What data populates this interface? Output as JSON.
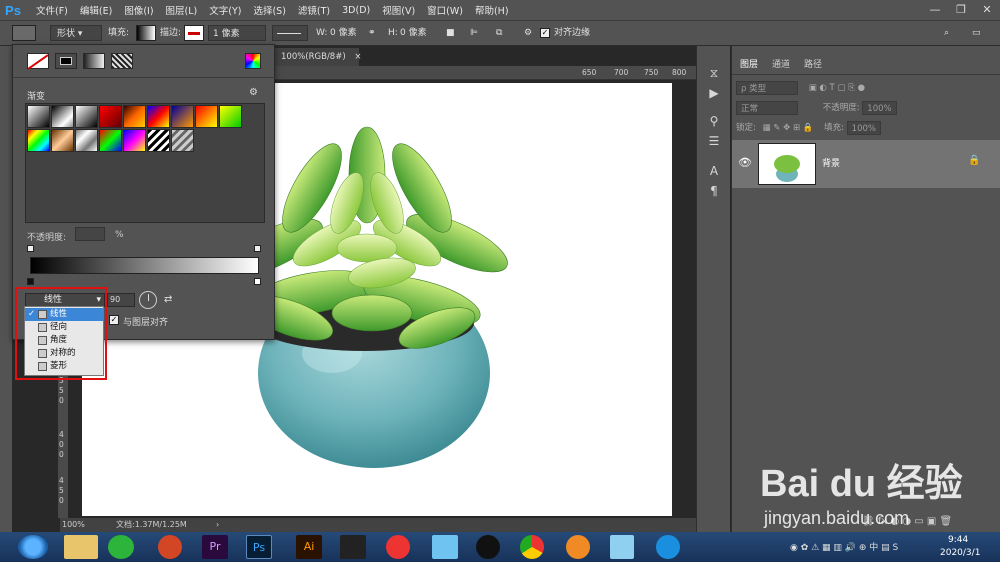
{
  "app": {
    "logo": "Ps"
  },
  "menu": [
    "文件(F)",
    "编辑(E)",
    "图像(I)",
    "图层(L)",
    "文字(Y)",
    "选择(S)",
    "滤镜(T)",
    "3D(D)",
    "视图(V)",
    "窗口(W)",
    "帮助(H)"
  ],
  "window_controls": [
    "—",
    "❐",
    "✕"
  ],
  "options_bar": {
    "mode": "形状",
    "fill_label": "填充:",
    "stroke_label": "描边:",
    "stroke_width": "1 像素",
    "w_label": "W:",
    "w_value": "0 像素",
    "h_label": "H:",
    "h_value": "0 像素",
    "align_edges": "对齐边缘"
  },
  "doc_tab": {
    "title": "100%(RGB/8#)",
    "close": "×"
  },
  "ruler": {
    "h_ticks": [
      "650",
      "700",
      "750",
      "800"
    ],
    "v_ticks": [
      "3",
      "5",
      "0",
      "3",
      "5",
      "0",
      "4",
      "0",
      "0",
      "4",
      "5",
      "0"
    ]
  },
  "status": {
    "zoom": "100%",
    "doc": "文档:1.37M/1.25M",
    "arrow": "›"
  },
  "gradient_panel": {
    "section_label": "渐变",
    "opacity_label": "不透明度:",
    "opacity_unit": "%",
    "angle_value": "90",
    "type_selected": "线性",
    "align_label": "与图层对齐"
  },
  "gradient_types": [
    {
      "label": "线性",
      "selected": true
    },
    {
      "label": "径向",
      "selected": false
    },
    {
      "label": "角度",
      "selected": false
    },
    {
      "label": "对称的",
      "selected": false
    },
    {
      "label": "菱形",
      "selected": false
    }
  ],
  "layers_panel": {
    "tabs": [
      "图层",
      "通道",
      "路径"
    ],
    "kind_placeholder": "ρ 类型",
    "blend_mode": "正常",
    "opacity_label": "不透明度:",
    "opacity_value": "100%",
    "lock_label": "锁定:",
    "fill_label": "填充:",
    "fill_value": "100%",
    "layer_name": "背景"
  },
  "right_strip_icons": [
    "history-icon",
    "play-icon",
    "adjust-icon",
    "properties-icon",
    "character-icon",
    "paragraph-icon"
  ],
  "clock": {
    "time": "9:44",
    "date": "2020/3/1"
  },
  "watermark": {
    "brand": "Bai du 经验",
    "url": "jingyan.baidu.com"
  },
  "colors": {
    "ui_bg": "#535353",
    "workspace": "#282828",
    "taskbar": "#1d3c66",
    "highlight": "#e01010",
    "selection": "#3b86d6"
  }
}
